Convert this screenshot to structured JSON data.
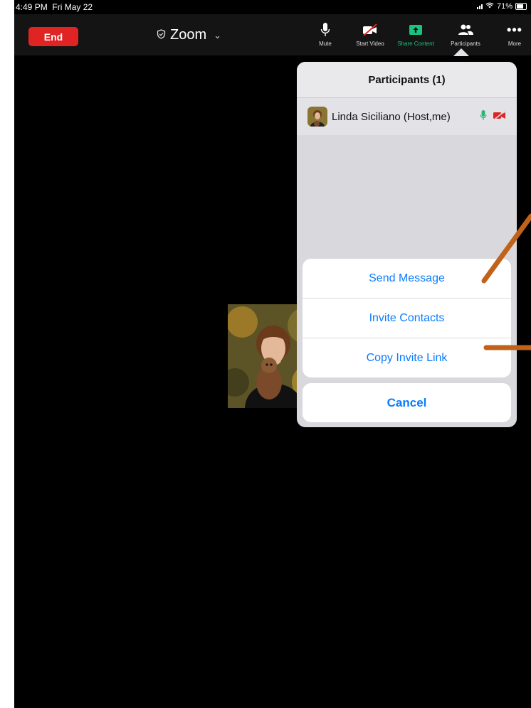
{
  "status_bar": {
    "time": "4:49 PM",
    "date": "Fri May 22",
    "battery": "71%"
  },
  "toolbar": {
    "end_label": "End",
    "meeting_title": "Zoom",
    "items": [
      {
        "label": "Mute",
        "icon": "microphone-icon"
      },
      {
        "label": "Start Video",
        "icon": "video-off-icon"
      },
      {
        "label": "Share Content",
        "icon": "share-screen-icon"
      },
      {
        "label": "Participants",
        "icon": "participants-icon"
      },
      {
        "label": "More",
        "icon": "more-icon"
      }
    ]
  },
  "participants_panel": {
    "title": "Participants (1)",
    "participants": [
      {
        "name": "Linda Siciliano (Host,me)",
        "mic_icon": "microphone-green-icon",
        "video_icon": "video-off-red-icon"
      }
    ]
  },
  "action_sheet": {
    "items": [
      "Send Message",
      "Invite Contacts",
      "Copy Invite Link"
    ],
    "cancel_label": "Cancel"
  },
  "colors": {
    "end_red": "#e02424",
    "ios_blue": "#0a7cff",
    "share_green": "#19c37d",
    "annotation_orange": "#c0621a"
  }
}
